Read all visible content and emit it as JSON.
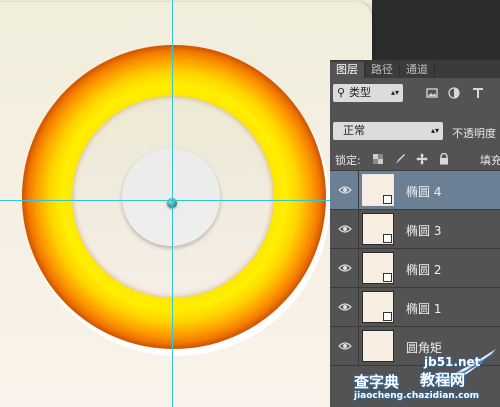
{
  "layers_panel": {
    "tabs": [
      {
        "label": "图层",
        "active": true
      },
      {
        "label": "路径",
        "active": false
      },
      {
        "label": "通道",
        "active": false
      }
    ],
    "kind_filter": "类型",
    "filter_icons": [
      "image-icon",
      "adjustment-icon",
      "type-icon"
    ],
    "blend_mode": "正常",
    "opacity_label": "不透明度",
    "lock_label": "锁定:",
    "lock_icons": [
      "lock-transparent-icon",
      "lock-paint-icon",
      "lock-move-icon",
      "lock-all-icon"
    ],
    "fill_label": "填充",
    "layers": [
      {
        "name": "椭圆 4",
        "selected": true,
        "visible": true
      },
      {
        "name": "椭圆 3",
        "selected": false,
        "visible": true
      },
      {
        "name": "椭圆 2",
        "selected": false,
        "visible": true
      },
      {
        "name": "椭圆 1",
        "selected": false,
        "visible": true
      },
      {
        "name": "圆角矩",
        "selected": false,
        "visible": true
      }
    ]
  },
  "canvas": {
    "ring_outer_color": "#e06000",
    "ring_inner_color": "#ffef00",
    "guide_color": "#33c6d6"
  },
  "watermark": {
    "top": "jb51.net",
    "middle": "教程网",
    "bottom": "jiaocheng.chazidian.com",
    "left": "查字典"
  }
}
